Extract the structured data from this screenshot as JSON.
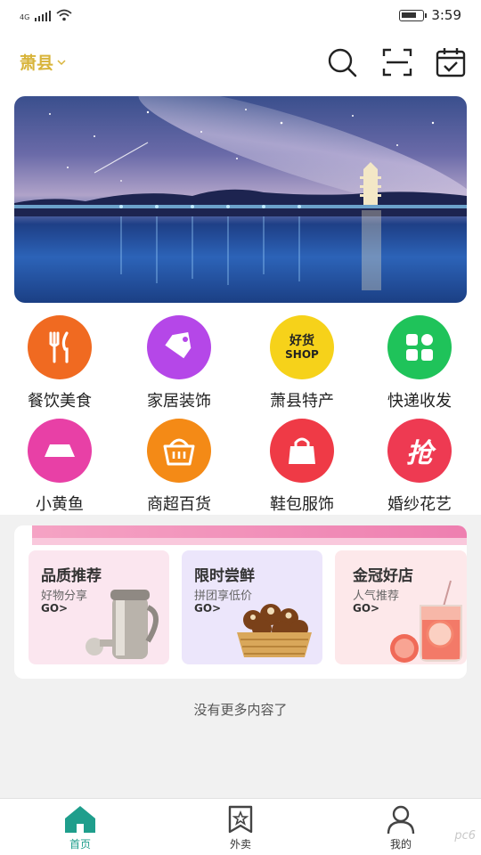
{
  "status_bar": {
    "network": "4G",
    "time": "3:59"
  },
  "header": {
    "city": "萧县"
  },
  "categories": [
    {
      "label": "餐饮美食",
      "icon": "fork-knife-icon",
      "color": "#f06a21"
    },
    {
      "label": "家居装饰",
      "icon": "price-tag-icon",
      "color": "#b547e8"
    },
    {
      "label": "萧县特产",
      "icon": "shop-badge-icon",
      "color": "#f6d21a",
      "badge_line1": "好货",
      "badge_line2": "SHOP"
    },
    {
      "label": "快递收发",
      "icon": "grid-icon",
      "color": "#1fc35a"
    },
    {
      "label": "小黄鱼",
      "icon": "rectangle-icon",
      "color": "#e840a6"
    },
    {
      "label": "商超百货",
      "icon": "basket-icon",
      "color": "#f48a16"
    },
    {
      "label": "鞋包服饰",
      "icon": "bag-icon",
      "color": "#ef3a46"
    },
    {
      "label": "婚纱花艺",
      "icon": "grab-char-icon",
      "color": "#ee3a52",
      "glyph": "抢"
    }
  ],
  "promos": [
    {
      "title": "品质推荐",
      "subtitle": "好物分享",
      "go": "GO>",
      "bg": "#fbe6ef"
    },
    {
      "title": "限时尝鲜",
      "subtitle": "拼团享低价",
      "go": "GO>",
      "bg": "#ece6fb"
    },
    {
      "title": "金冠好店",
      "subtitle": "人气推荐",
      "go": "GO>",
      "bg": "#fde8ea"
    }
  ],
  "no_more_text": "没有更多内容了",
  "tabs": [
    {
      "label": "首页",
      "active": true
    },
    {
      "label": "外卖",
      "active": false
    },
    {
      "label": "我的",
      "active": false
    }
  ],
  "watermark": "pc6"
}
